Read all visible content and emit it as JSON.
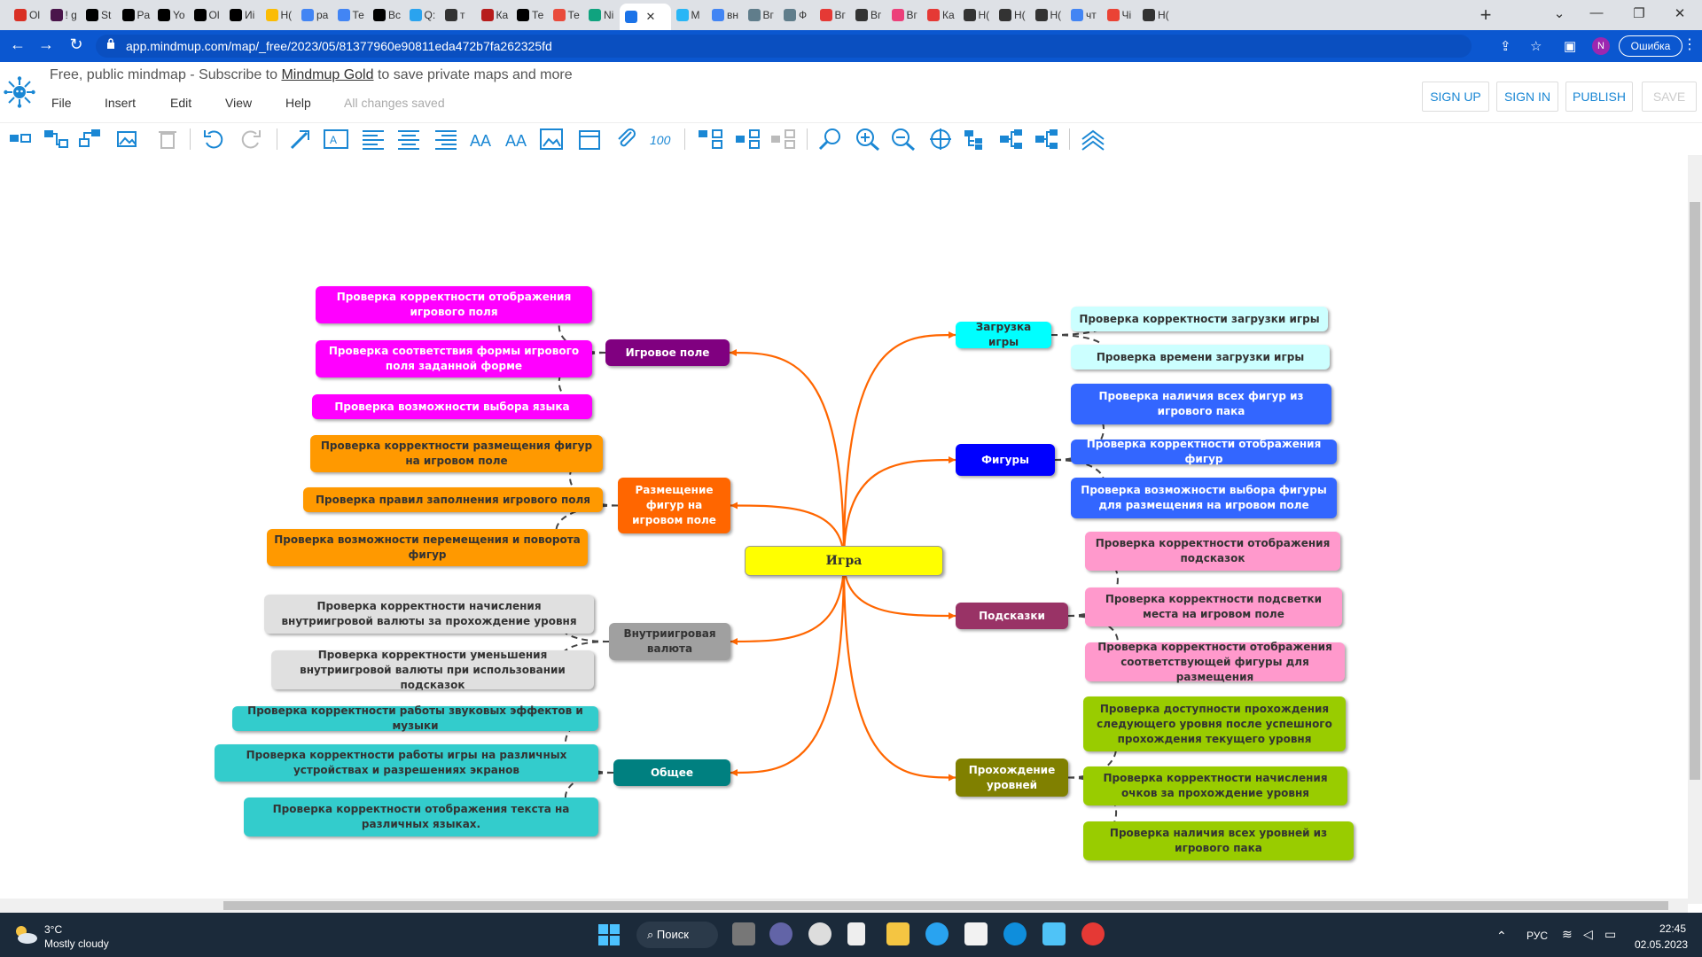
{
  "browser": {
    "tabs": [
      "Ol",
      "! g",
      "St",
      "Pa",
      "Yo",
      "Ol",
      "Иі",
      "Н(",
      "ра",
      "Те",
      "Вс",
      "Q:",
      "т",
      "Ка",
      "Те",
      "Те",
      "Ni",
      "",
      "М",
      "вн",
      "Вг",
      "Ф",
      "Вг",
      "Вг",
      "Вг",
      "Ка",
      "Н(",
      "Н(",
      "Н(",
      "чт",
      "Чі",
      "Н("
    ],
    "tab_colors": [
      "#d93025",
      "#4a154b",
      "#000000",
      "#000000",
      "#000000",
      "#000000",
      "#000000",
      "#fbbc04",
      "#4285f4",
      "#4285f4",
      "#000000",
      "#2aa3ef",
      "#333333",
      "#b71c1c",
      "#000000",
      "#e94b3c",
      "#10a37f",
      "#1b73e8",
      "#29b6f6",
      "#4285f4",
      "#607d8b",
      "#607d8b",
      "#e53935",
      "#333333",
      "#ec407a",
      "#e53935",
      "#333333",
      "#333333",
      "#333333",
      "#4285f4",
      "#ea4335",
      "#333333"
    ],
    "active_tab_index": 17,
    "url": "app.mindmup.com/map/_free/2023/05/81377960e90811eda472b7fa262325fd",
    "profile_initial": "N",
    "error_label": "Ошибка"
  },
  "app": {
    "subtitle_prefix": "Free, public mindmap - Subscribe to ",
    "subtitle_link": "Mindmup Gold",
    "subtitle_suffix": " to save private maps and more",
    "menu": [
      "File",
      "Insert",
      "Edit",
      "View",
      "Help"
    ],
    "save_status": "All changes saved",
    "buttons": {
      "sign_up": "SIGN UP",
      "sign_in": "SIGN IN",
      "publish": "PUBLISH",
      "save": "SAVE"
    },
    "accent_color": "#1a87d4"
  },
  "mindmap": {
    "root": {
      "label": "Игра",
      "color": "#ffff00"
    },
    "branches": [
      {
        "label": "Игровое поле",
        "color": "#800080",
        "children": [
          {
            "label": "Проверка корректности отображения игрового поля",
            "color": "#ff00ff"
          },
          {
            "label": "Проверка соответствия формы игрового поля заданной форме",
            "color": "#ff00ff"
          },
          {
            "label": "Проверка возможности выбора языка",
            "color": "#ff00ff"
          }
        ]
      },
      {
        "label": "Размещение фигур на игровом поле",
        "color": "#ff6600",
        "children": [
          {
            "label": "Проверка корректности размещения фигур на игровом поле",
            "color": "#ff9900"
          },
          {
            "label": "Проверка правил заполнения игрового поля",
            "color": "#ff9900"
          },
          {
            "label": "Проверка возможности перемещения и поворота фигур",
            "color": "#ff9900"
          }
        ]
      },
      {
        "label": "Внутриигровая валюта",
        "color": "#a0a0a0",
        "children": [
          {
            "label": "Проверка корректности начисления внутриигровой валюты за прохождение уровня",
            "color": "#e0e0e0"
          },
          {
            "label": "Проверка корректности уменьшения внутриигровой валюты при использовании подсказок",
            "color": "#e0e0e0"
          }
        ]
      },
      {
        "label": "Общее",
        "color": "#008080",
        "children": [
          {
            "label": "Проверка корректности работы звуковых эффектов и музыки",
            "color": "#33cccc"
          },
          {
            "label": "Проверка корректности работы игры на различных устройствах и разрешениях экранов",
            "color": "#33cccc"
          },
          {
            "label": "Проверка корректности отображения текста на различных языках.",
            "color": "#33cccc"
          }
        ]
      },
      {
        "label": "Загрузка игры",
        "color": "#00ffff",
        "children": [
          {
            "label": "Проверка корректности загрузки игры",
            "color": "#ccffff"
          },
          {
            "label": "Проверка времени загрузки игры",
            "color": "#ccffff"
          }
        ]
      },
      {
        "label": "Фигуры",
        "color": "#0000ff",
        "children": [
          {
            "label": "Проверка наличия всех фигур из игрового пака",
            "color": "#3366ff"
          },
          {
            "label": "Проверка корректности отображения фигур",
            "color": "#3366ff"
          },
          {
            "label": "Проверка возможности выбора фигуры для размещения на игровом поле",
            "color": "#3366ff"
          }
        ]
      },
      {
        "label": "Подсказки",
        "color": "#993366",
        "children": [
          {
            "label": "Проверка корректности отображения подсказок",
            "color": "#ff99cc"
          },
          {
            "label": "Проверка корректности подсветки места на игровом поле",
            "color": "#ff99cc"
          },
          {
            "label": "Проверка корректности отображения соответствующей фигуры для размещения",
            "color": "#ff99cc"
          }
        ]
      },
      {
        "label": "Прохождение уровней",
        "color": "#808000",
        "children": [
          {
            "label": "Проверка доступности прохождения следующего уровня после успешного прохождения текущего уровня",
            "color": "#99cc00"
          },
          {
            "label": "Проверка корректности начисления очков за прохождение уровня",
            "color": "#99cc00"
          },
          {
            "label": "Проверка наличия всех уровней из игрового пака",
            "color": "#99cc00"
          }
        ]
      }
    ],
    "connector_color": "#ff6600"
  },
  "taskbar": {
    "weather_temp": "3°C",
    "weather_desc": "Mostly cloudy",
    "search_label": "Поиск",
    "language": "РУС",
    "time": "22:45",
    "date": "02.05.2023"
  }
}
